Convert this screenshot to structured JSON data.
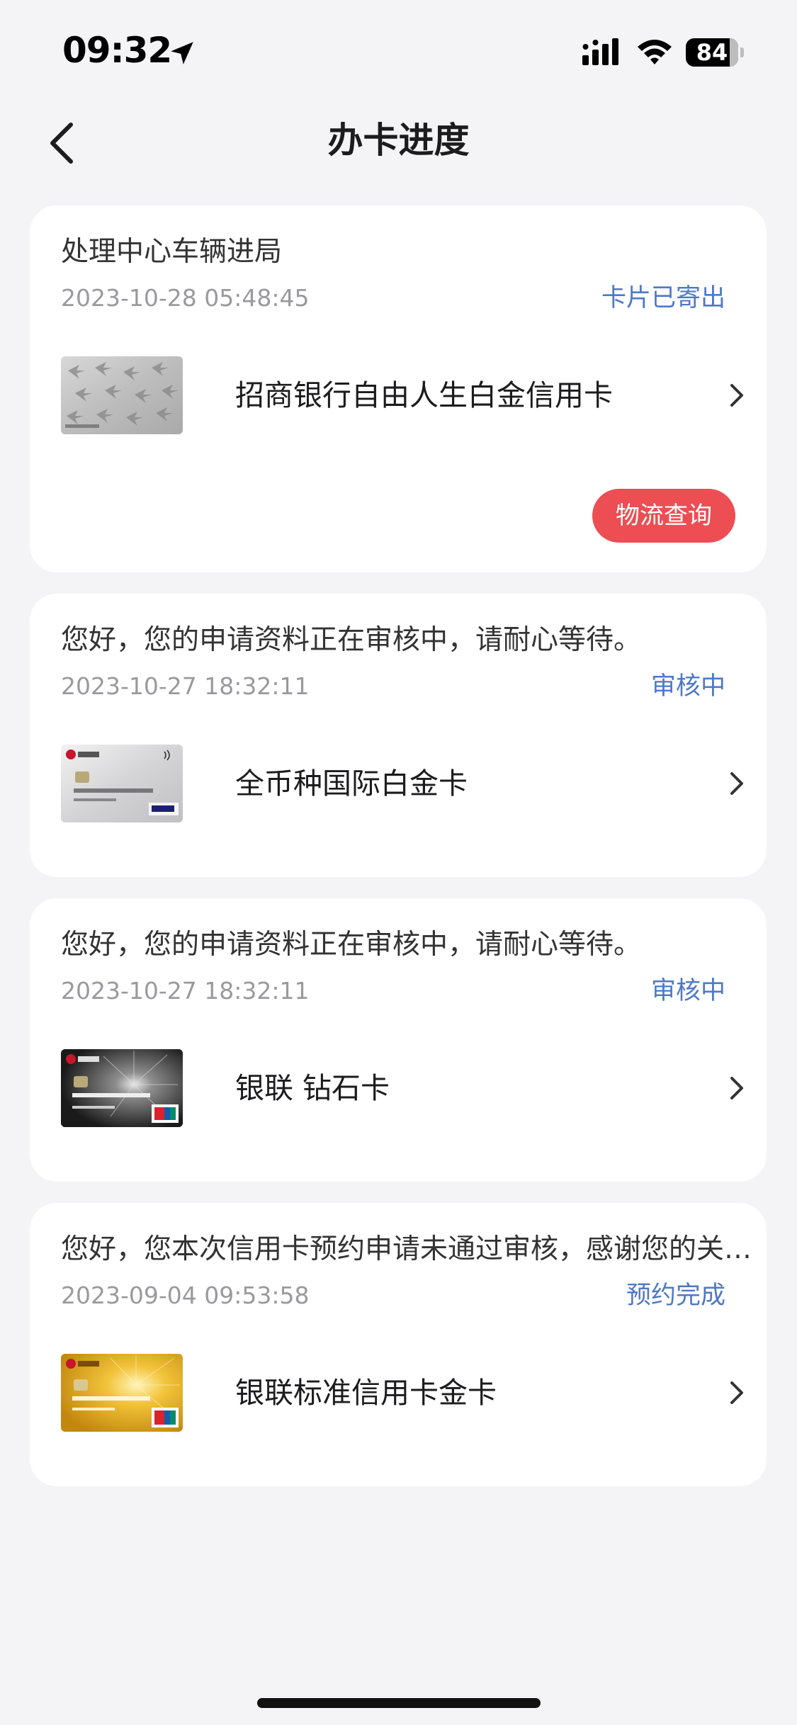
{
  "status_bar": {
    "time": "09:32",
    "battery": "84",
    "battery_level": 0.84
  },
  "nav": {
    "title": "办卡进度",
    "back_icon": "chevron-left-icon"
  },
  "cards": [
    {
      "message": "处理中心车辆进局",
      "time": "2023-10-28 05:48:45",
      "status": "卡片已寄出",
      "status_color": "#4f79c4",
      "card_name": "招商银行自由人生白金信用卡",
      "thumb_style": "silver-birds",
      "button": "物流查询",
      "button_color": "#ec4e53"
    },
    {
      "message": "您好，您的申请资料正在审核中，请耐心等待。",
      "time": "2023-10-27 18:32:11",
      "status": "审核中",
      "status_color": "#4f79c4",
      "card_name": "全币种国际白金卡",
      "thumb_style": "silver-visa"
    },
    {
      "message": "您好，您的申请资料正在审核中，请耐心等待。",
      "time": "2023-10-27 18:32:11",
      "status": "审核中",
      "status_color": "#4f79c4",
      "card_name": "银联 钻石卡",
      "thumb_style": "black-diamond"
    },
    {
      "message": "您好，您本次信用卡预约申请未通过审核，感谢您的关注。",
      "time": "2023-09-04 09:53:58",
      "status": "预约完成",
      "status_color": "#4f79c4",
      "card_name": "银联标准信用卡金卡",
      "thumb_style": "gold-unionpay"
    }
  ]
}
